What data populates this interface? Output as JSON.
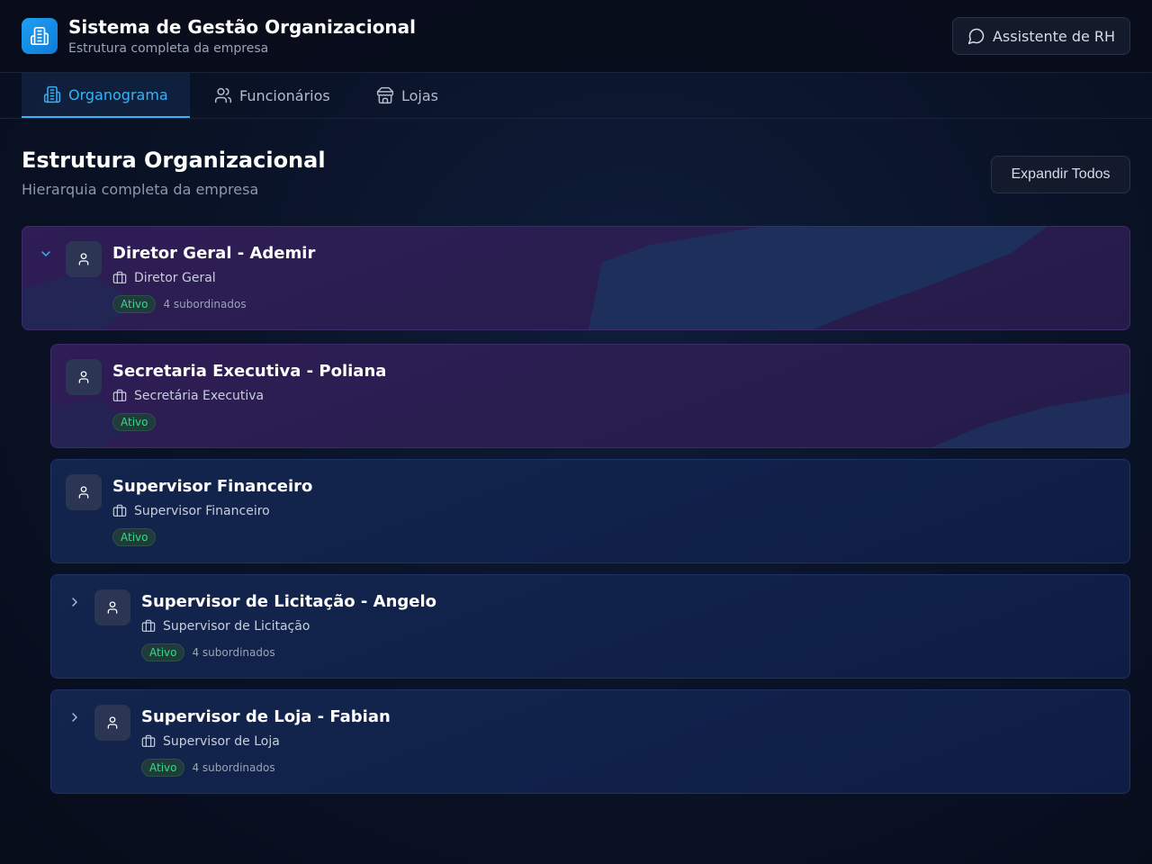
{
  "header": {
    "title": "Sistema de Gestão Organizacional",
    "subtitle": "Estrutura completa da empresa",
    "logo_icon": "building-icon",
    "assistant_button": "Assistente de RH",
    "assistant_icon": "chat-bubble-icon"
  },
  "tabs": [
    {
      "label": "Organograma",
      "icon": "building-icon",
      "active": true
    },
    {
      "label": "Funcionários",
      "icon": "users-icon",
      "active": false
    },
    {
      "label": "Lojas",
      "icon": "store-icon",
      "active": false
    }
  ],
  "section": {
    "title": "Estrutura Organizacional",
    "subtitle": "Hierarquia completa da empresa",
    "expand_button": "Expandir Todos"
  },
  "nodes": [
    {
      "title": "Diretor Geral - Ademir",
      "role": "Diretor Geral",
      "status": "Ativo",
      "subordinates": "4 subordinados",
      "expanded": true
    },
    {
      "title": "Secretaria Executiva - Poliana",
      "role": "Secretária Executiva",
      "status": "Ativo",
      "subordinates": ""
    },
    {
      "title": "Supervisor Financeiro",
      "role": "Supervisor Financeiro",
      "status": "Ativo",
      "subordinates": ""
    },
    {
      "title": "Supervisor de Licitação - Angelo",
      "role": "Supervisor de Licitação",
      "status": "Ativo",
      "subordinates": "4 subordinados",
      "expanded": false
    },
    {
      "title": "Supervisor de Loja - Fabian",
      "role": "Supervisor de Loja",
      "status": "Ativo",
      "subordinates": "4 subordinados",
      "expanded": false
    }
  ],
  "colors": {
    "accent": "#38b2f5",
    "status_active": "#3dd68c",
    "card_purple": "#2a1d50",
    "card_blue": "#10214a"
  }
}
